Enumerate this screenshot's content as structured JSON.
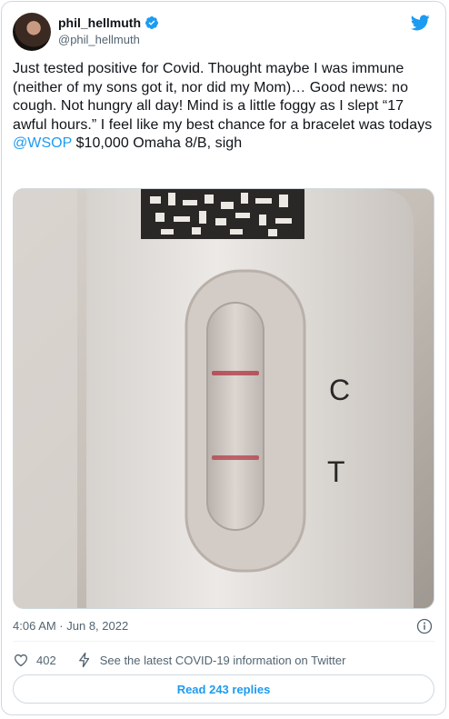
{
  "user": {
    "display_name": "phil_hellmuth",
    "handle": "@phil_hellmuth",
    "verified": true,
    "avatar": "profile-photo"
  },
  "brand": {
    "logo": "twitter-bird-icon",
    "accent": "#1d9bf0"
  },
  "tweet": {
    "text_before": "Just tested positive for Covid. Thought maybe I was immune (neither of my sons got it, nor did my Mom)… Good news: no cough. Not hungry all day! Mind is a little foggy as I slept “17 awful hours.” I feel like my best chance for a bracelet was todays ",
    "mention": "@WSOP",
    "text_after": " $10,000 Omaha 8/B, sigh",
    "media": {
      "description": "rapid antigen covid test cassette",
      "control_label": "C",
      "test_label": "T"
    },
    "timestamp": "4:06 AM · Jun 8, 2022"
  },
  "actions": {
    "like_count": "402",
    "covid_info": "See the latest COVID-19 information on Twitter"
  },
  "replies_button": "Read 243 replies"
}
